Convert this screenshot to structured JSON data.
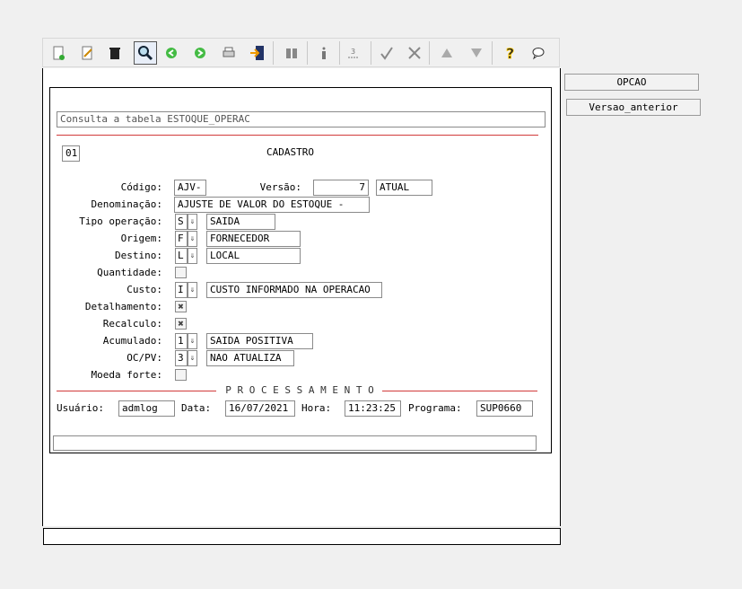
{
  "toolbar": {
    "icons": [
      "new-doc-icon",
      "edit-icon",
      "trash-icon",
      "search-icon",
      "back-icon",
      "forward-icon",
      "print-icon",
      "export-icon",
      "binoculars-icon",
      "info-icon",
      "numbering-icon",
      "check-icon",
      "tools-icon",
      "up-icon",
      "down-icon",
      "help-icon",
      "chat-icon"
    ]
  },
  "side_buttons": {
    "opcao": "OPCAO",
    "versao": "Versao_anterior"
  },
  "form": {
    "title": "Consulta a tabela ESTOQUE_OPERAC",
    "tab_number": "01",
    "section": "CADASTRO",
    "codigo_label": "Código:",
    "codigo_value": "AJV-",
    "versao_label": "Versão:",
    "versao_value": "7",
    "versao_status": "ATUAL",
    "denominacao_label": "Denominação:",
    "denominacao_value": "AJUSTE DE VALOR DO ESTOQUE -",
    "tipo_label": "Tipo operação:",
    "tipo_code": "S",
    "tipo_desc": "SAIDA",
    "origem_label": "Origem:",
    "origem_code": "F",
    "origem_desc": "FORNECEDOR",
    "destino_label": "Destino:",
    "destino_code": "L",
    "destino_desc": "LOCAL",
    "quantidade_label": "Quantidade:",
    "custo_label": "Custo:",
    "custo_code": "I",
    "custo_desc": "CUSTO INFORMADO NA OPERACAO",
    "detalhamento_label": "Detalhamento:",
    "recalculo_label": "Recalculo:",
    "acumulado_label": "Acumulado:",
    "acumulado_code": "1",
    "acumulado_desc": "SAIDA POSITIVA",
    "ocpv_label": "OC/PV:",
    "ocpv_code": "3",
    "ocpv_desc": "NAO ATUALIZA",
    "moeda_label": "Moeda forte:",
    "processamento": "P R O C E S S A M E N T O",
    "usuario_label": "Usuário:",
    "usuario_value": "admlog",
    "data_label": "Data:",
    "data_value": "16/07/2021",
    "hora_label": "Hora:",
    "hora_value": "11:23:25",
    "programa_label": "Programa:",
    "programa_value": "SUP0660",
    "dropdown_glyph": "⇓",
    "checked_glyph": "✖"
  }
}
